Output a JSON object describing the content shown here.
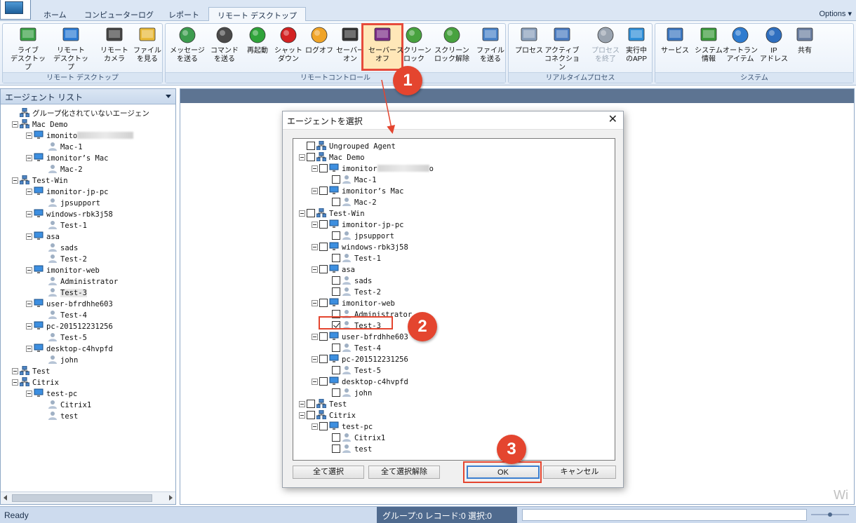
{
  "tabs": [
    {
      "label": "ホーム"
    },
    {
      "label": "コンピューターログ"
    },
    {
      "label": "レポート"
    },
    {
      "label": "リモート デスクトップ"
    }
  ],
  "options_label": "Options",
  "ribbon": {
    "groups": [
      {
        "label": "リモート デスクトップ"
      },
      {
        "label": "リモートコントロール"
      },
      {
        "label": "リアルタイムプロセス"
      },
      {
        "label": "システム"
      }
    ],
    "buttons": [
      {
        "label": "ライブ\nデスクトップ",
        "icon": "monitor-icon"
      },
      {
        "label": "リモート\nデスクトップ",
        "icon": "remote-desktop-icon"
      },
      {
        "label": "リモート\nカメラ",
        "icon": "webcam-icon"
      },
      {
        "label": "ファイル\nを見る",
        "icon": "folder-icon"
      },
      {
        "label": "メッセージ\nを送る",
        "icon": "message-icon"
      },
      {
        "label": "コマンド\nを送る",
        "icon": "command-icon"
      },
      {
        "label": "再起動",
        "icon": "restart-icon"
      },
      {
        "label": "シャット\nダウン",
        "icon": "power-icon"
      },
      {
        "label": "ログオフ",
        "icon": "key-icon"
      },
      {
        "label": "セーバー\nオン",
        "icon": "saver-on-icon"
      },
      {
        "label": "セーバー\nオフ",
        "icon": "saver-off-icon"
      },
      {
        "label": "スクリーン\nロック",
        "icon": "screen-lock-icon"
      },
      {
        "label": "スクリーン\nロック解除",
        "icon": "screen-unlock-icon"
      },
      {
        "label": "ファイル\nを送る",
        "icon": "send-file-icon"
      },
      {
        "label": "プロセス",
        "icon": "process-icon"
      },
      {
        "label": "アクティブ\nコネクション",
        "icon": "network-icon"
      },
      {
        "label": "プロセス\nを終了",
        "icon": "kill-process-icon"
      },
      {
        "label": "実行中\nのAPP",
        "icon": "apps-icon"
      },
      {
        "label": "サービス",
        "icon": "services-icon"
      },
      {
        "label": "システム\n情報",
        "icon": "system-info-icon"
      },
      {
        "label": "オートラン\nアイテム",
        "icon": "gear-icon"
      },
      {
        "label": "IP\nアドレス",
        "icon": "ip-icon"
      },
      {
        "label": "共有",
        "icon": "share-icon"
      }
    ]
  },
  "agent_list": {
    "title": "エージェント リスト",
    "items": [
      {
        "label": "グループ化されていないエージェン",
        "type": "group"
      },
      {
        "label": "Mac Demo",
        "type": "group"
      },
      {
        "label": "imonito",
        "type": "computer"
      },
      {
        "label": "Mac-1",
        "type": "user"
      },
      {
        "label": "imonitor’s Mac",
        "type": "computer"
      },
      {
        "label": "Mac-2",
        "type": "user"
      },
      {
        "label": "Test-Win",
        "type": "group"
      },
      {
        "label": "imonitor-jp-pc",
        "type": "computer"
      },
      {
        "label": "jpsupport",
        "type": "user"
      },
      {
        "label": "windows-rbk3j58",
        "type": "computer"
      },
      {
        "label": "Test-1",
        "type": "user"
      },
      {
        "label": "asa",
        "type": "computer"
      },
      {
        "label": "sads",
        "type": "user"
      },
      {
        "label": "Test-2",
        "type": "user"
      },
      {
        "label": "imonitor-web",
        "type": "computer"
      },
      {
        "label": "Administrator",
        "type": "user"
      },
      {
        "label": "Test-3",
        "type": "user"
      },
      {
        "label": "user-bfrdhhe603",
        "type": "computer"
      },
      {
        "label": "Test-4",
        "type": "user"
      },
      {
        "label": "pc-201512231256",
        "type": "computer"
      },
      {
        "label": "Test-5",
        "type": "user"
      },
      {
        "label": "desktop-c4hvpfd",
        "type": "computer"
      },
      {
        "label": "john",
        "type": "user"
      },
      {
        "label": "Test",
        "type": "group"
      },
      {
        "label": "Citrix",
        "type": "group"
      },
      {
        "label": "test-pc",
        "type": "computer"
      },
      {
        "label": "Citrix1",
        "type": "user"
      },
      {
        "label": "test",
        "type": "user"
      }
    ]
  },
  "dialog": {
    "title": "エージェントを選択",
    "close": "✕",
    "items": [
      {
        "label": "Ungrouped Agent",
        "type": "group",
        "checked": false
      },
      {
        "label": "Mac Demo",
        "type": "group",
        "checked": false
      },
      {
        "label": "imonitor",
        "suffix": "o",
        "type": "computer",
        "checked": false
      },
      {
        "label": "Mac-1",
        "type": "user",
        "checked": false
      },
      {
        "label": "imonitor’s Mac",
        "type": "computer",
        "checked": false
      },
      {
        "label": "Mac-2",
        "type": "user",
        "checked": false
      },
      {
        "label": "Test-Win",
        "type": "group",
        "checked": false
      },
      {
        "label": "imonitor-jp-pc",
        "type": "computer",
        "checked": false
      },
      {
        "label": "jpsupport",
        "type": "user",
        "checked": false
      },
      {
        "label": "windows-rbk3j58",
        "type": "computer",
        "checked": false
      },
      {
        "label": "Test-1",
        "type": "user",
        "checked": false
      },
      {
        "label": "asa",
        "type": "computer",
        "checked": false
      },
      {
        "label": "sads",
        "type": "user",
        "checked": false
      },
      {
        "label": "Test-2",
        "type": "user",
        "checked": false
      },
      {
        "label": "imonitor-web",
        "type": "computer",
        "checked": false
      },
      {
        "label": "Administrator",
        "type": "user",
        "checked": false
      },
      {
        "label": "Test-3",
        "type": "user",
        "checked": true
      },
      {
        "label": "user-bfrdhhe603",
        "type": "computer",
        "checked": false
      },
      {
        "label": "Test-4",
        "type": "user",
        "checked": false
      },
      {
        "label": "pc-201512231256",
        "type": "computer",
        "checked": false
      },
      {
        "label": "Test-5",
        "type": "user",
        "checked": false
      },
      {
        "label": "desktop-c4hvpfd",
        "type": "computer",
        "checked": false
      },
      {
        "label": "john",
        "type": "user",
        "checked": false
      },
      {
        "label": "Test",
        "type": "group",
        "checked": false
      },
      {
        "label": "Citrix",
        "type": "group",
        "checked": false
      },
      {
        "label": "test-pc",
        "type": "computer",
        "checked": false
      },
      {
        "label": "Citrix1",
        "type": "user",
        "checked": false
      },
      {
        "label": "test",
        "type": "user",
        "checked": false
      }
    ],
    "buttons": {
      "select_all": "全て選択",
      "deselect_all": "全て選択解除",
      "ok": "OK",
      "cancel": "キャンセル"
    }
  },
  "callouts": [
    "1",
    "2",
    "3"
  ],
  "statusbar": {
    "ready": "Ready",
    "counts": "グループ:0 レコード:0 選択:0"
  },
  "watermark": "Wi",
  "colors": {
    "accent": "#e4452f",
    "ribbon_bg": "#e3ecf7",
    "status_dark": "#4f6a8e"
  }
}
